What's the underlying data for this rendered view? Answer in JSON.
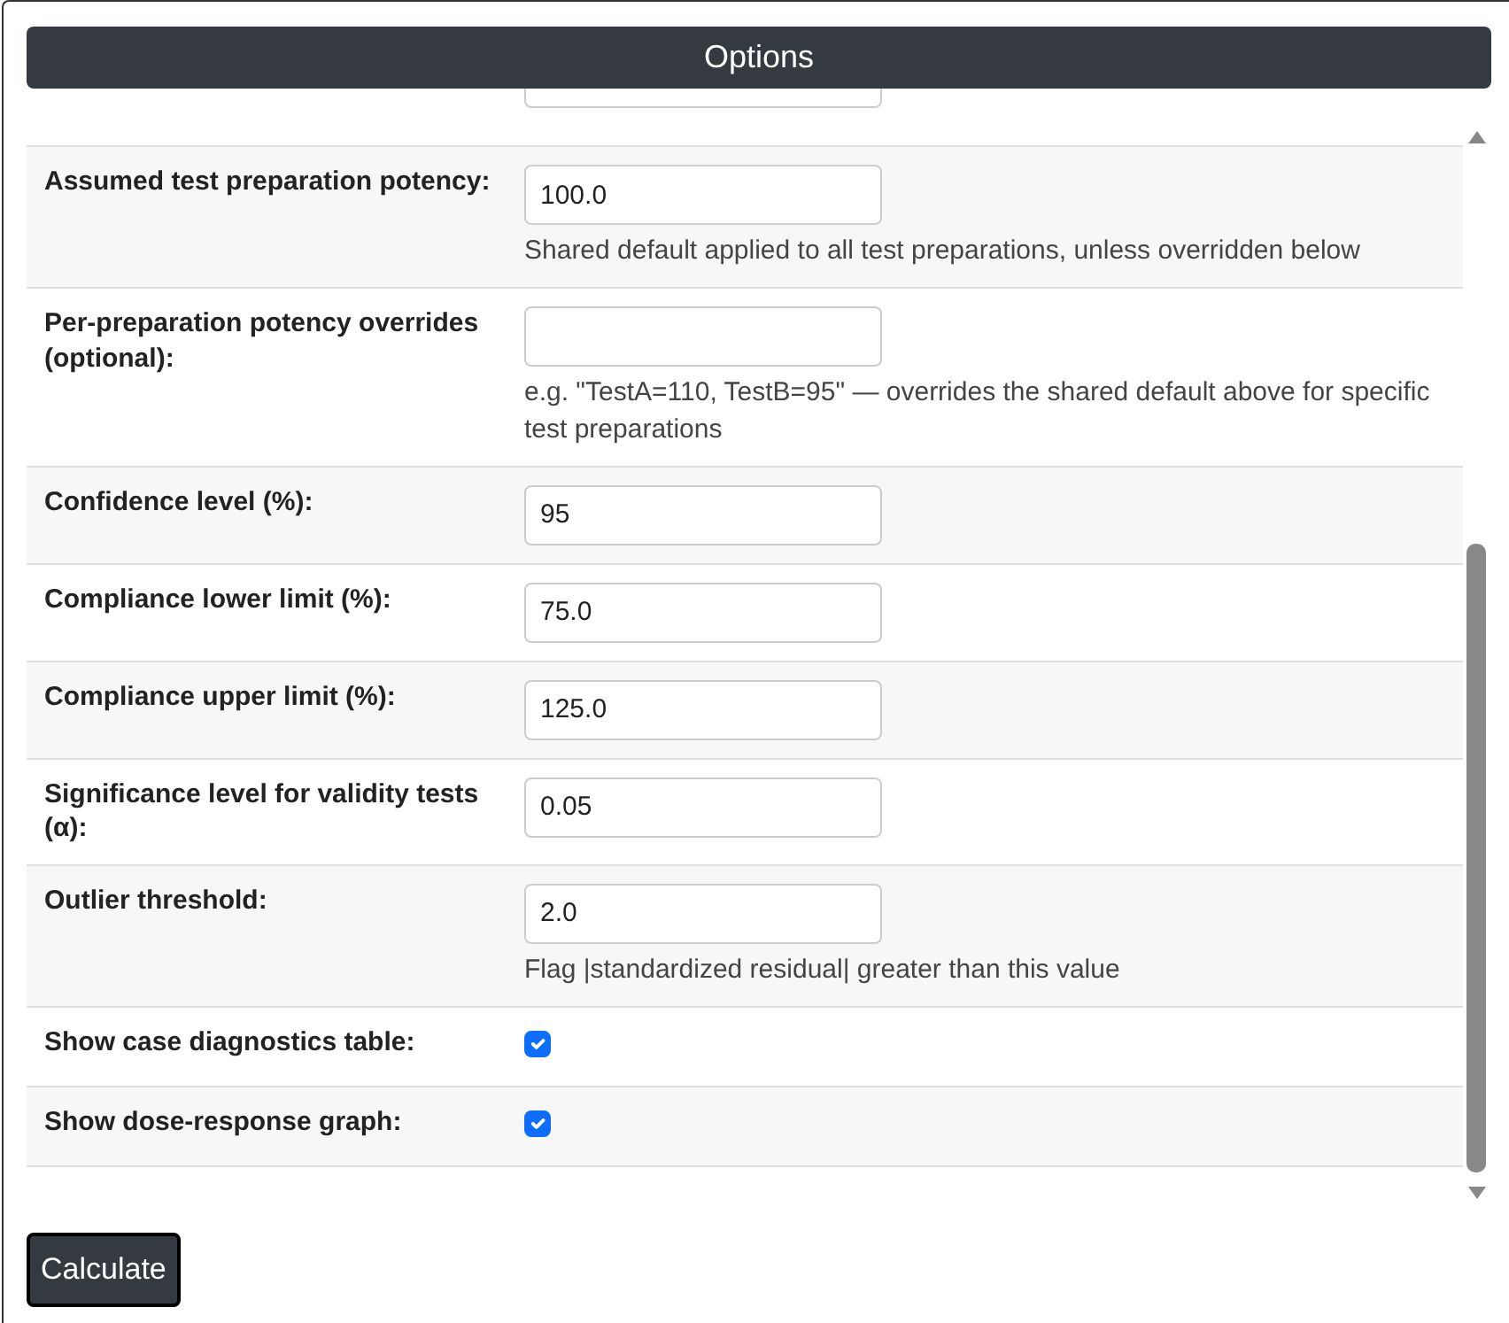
{
  "header": {
    "title": "Options"
  },
  "rows": [
    {
      "kind": "text",
      "label": "Assumed test preparation potency:",
      "value": "100.0",
      "hint": "Shared default applied to all test preparations, unless overridden below"
    },
    {
      "kind": "text",
      "label": "Per-preparation potency overrides (optional):",
      "hint": "e.g. \"TestA=110, TestB=95\" — overrides the shared default above for specific test preparations"
    },
    {
      "kind": "text",
      "label": "Confidence level (%):",
      "value": "95"
    },
    {
      "kind": "text",
      "label": "Compliance lower limit (%):",
      "value": "75.0"
    },
    {
      "kind": "text",
      "label": "Compliance upper limit (%):",
      "value": "125.0"
    },
    {
      "kind": "text",
      "label": "Significance level for validity tests (α):",
      "value": "0.05"
    },
    {
      "kind": "text",
      "label": "Outlier threshold:",
      "value": "2.0",
      "hint": "Flag |standardized residual| greater than this value"
    },
    {
      "kind": "checkbox",
      "label": "Show case diagnostics table:",
      "checked": true
    },
    {
      "kind": "checkbox",
      "label": "Show dose-response graph:",
      "checked": true
    }
  ],
  "button": {
    "label": "Calculate"
  }
}
